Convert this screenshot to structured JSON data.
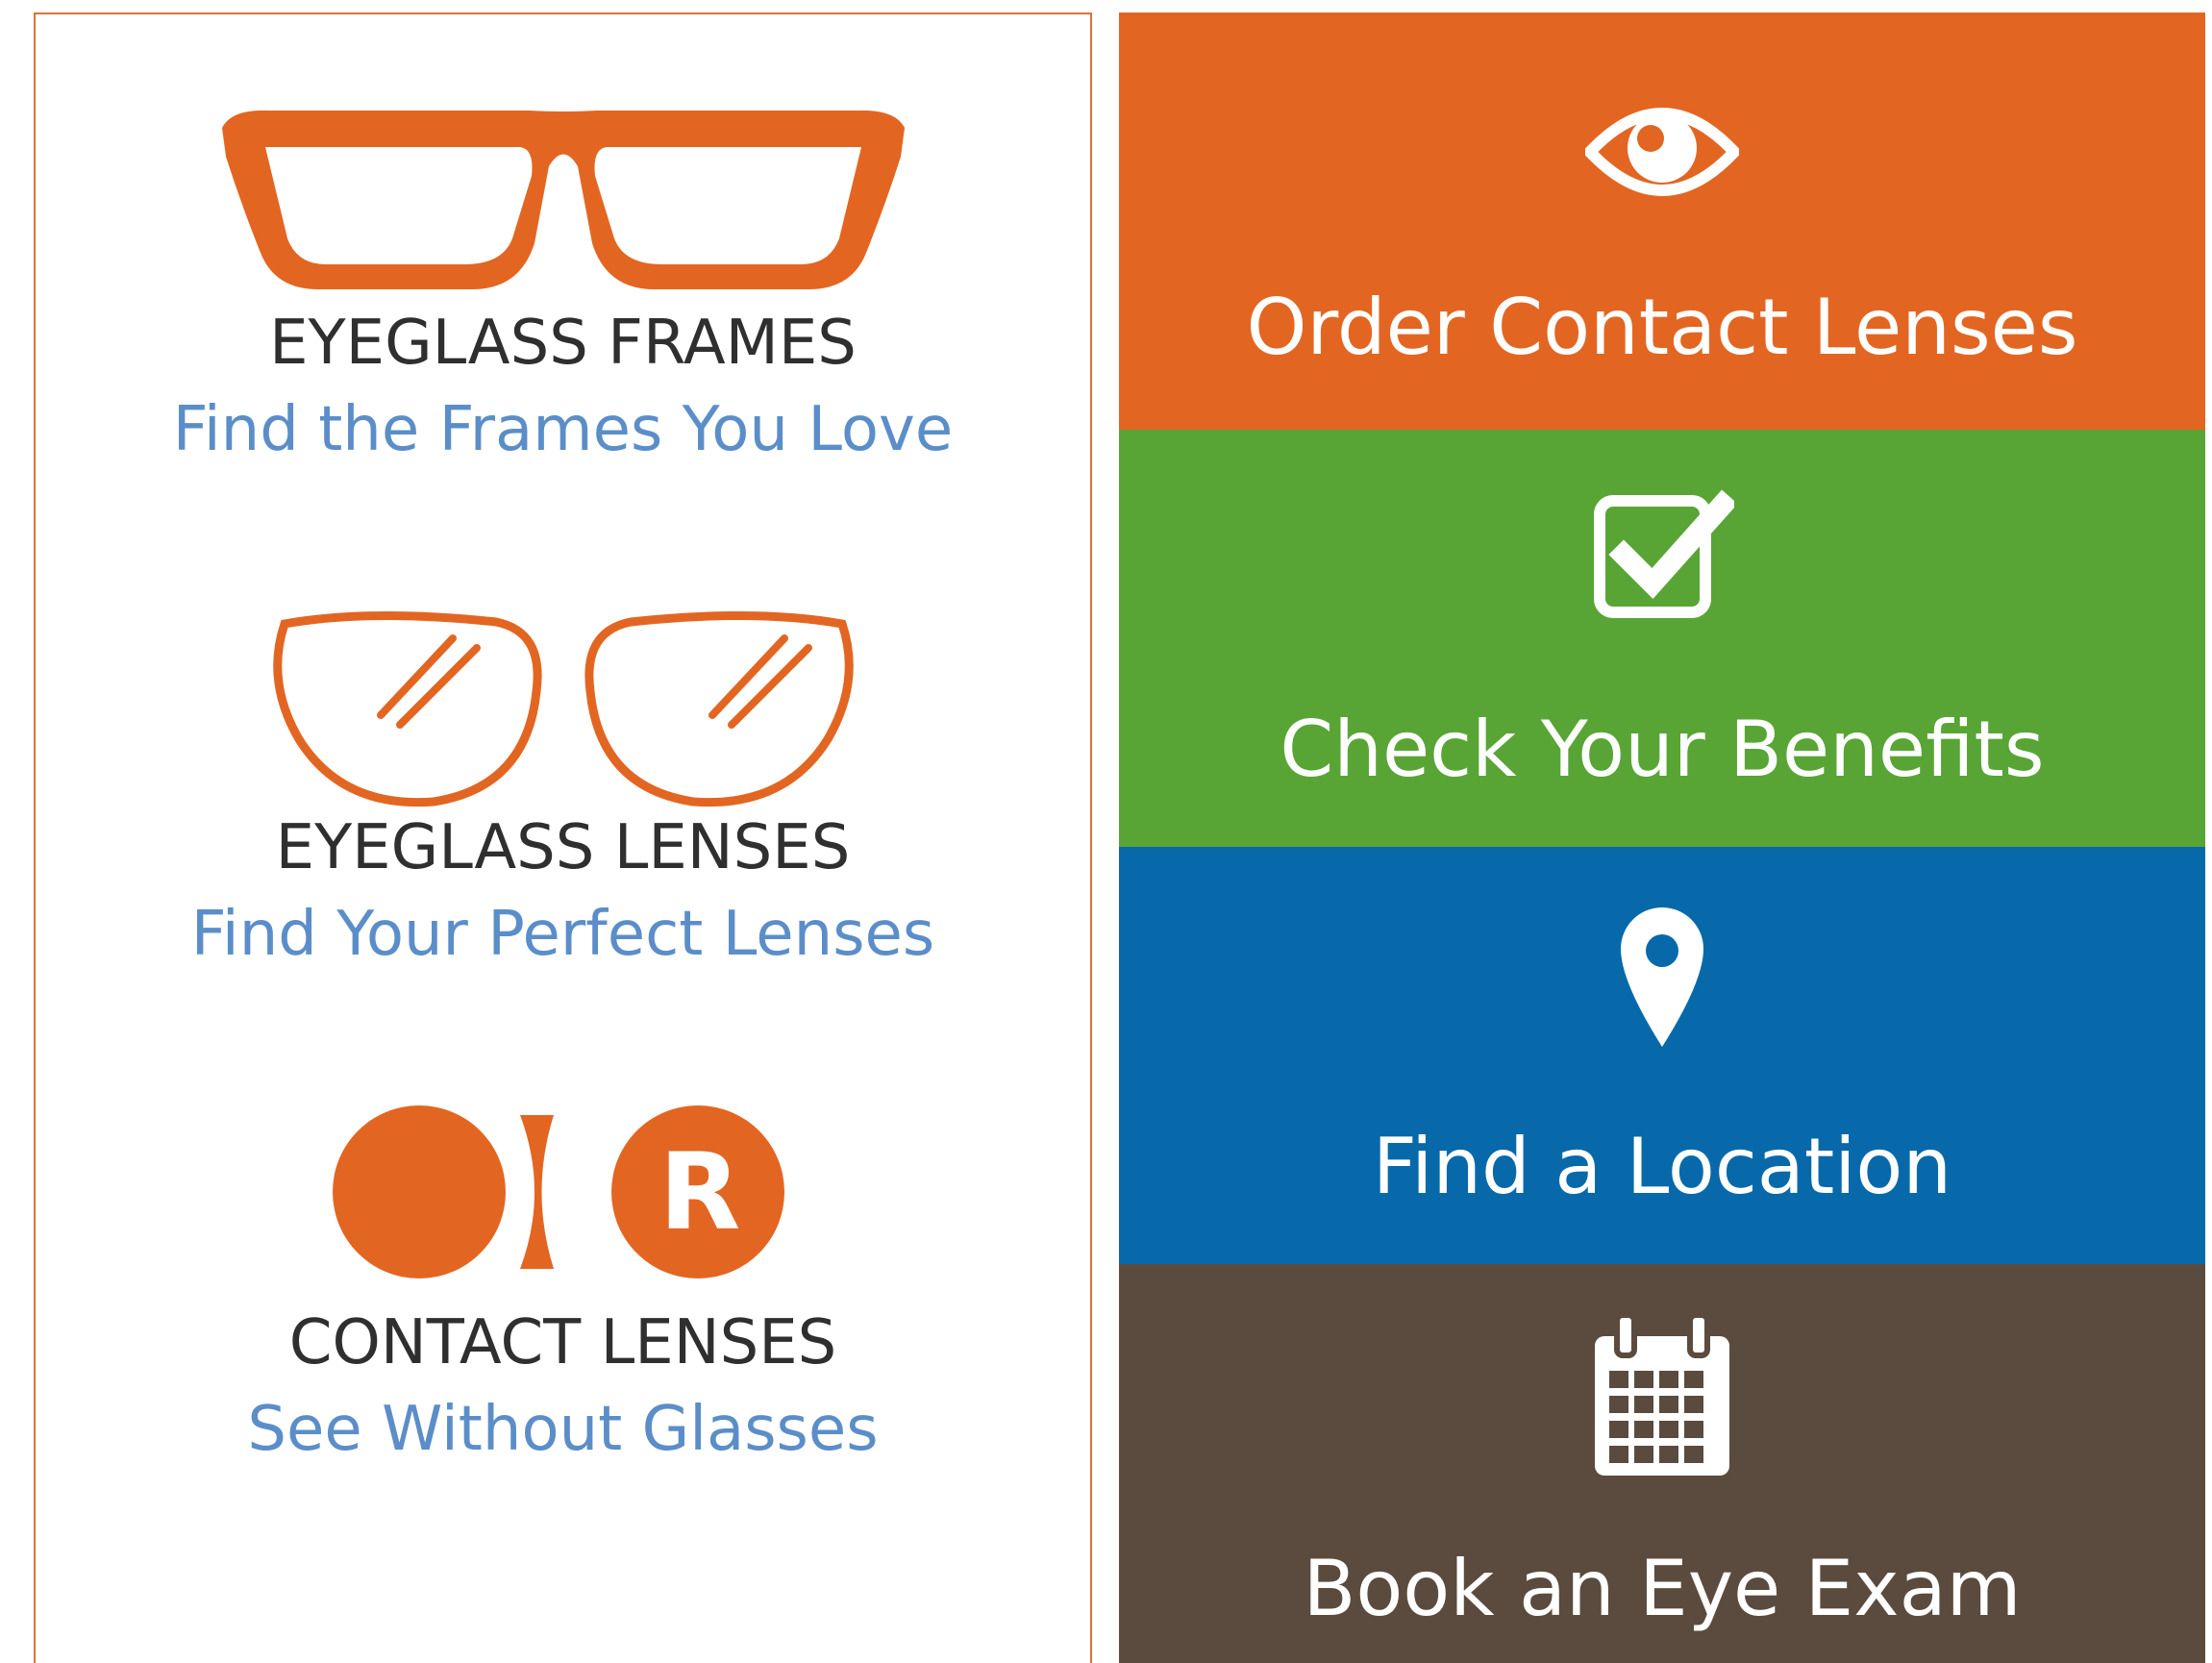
{
  "colors": {
    "orange": "#e26622",
    "green": "#58a535",
    "blue": "#0769aa",
    "brown": "#5b4b3e",
    "subtitle_blue": "#5b8ec9",
    "title_dark": "#2f2f2f"
  },
  "products": [
    {
      "title": "EYEGLASS FRAMES",
      "subtitle": "Find the Frames You Love",
      "icon": "eyeglass-frames-icon"
    },
    {
      "title": "EYEGLASS LENSES",
      "subtitle": "Find Your Perfect Lenses",
      "icon": "eyeglass-lenses-icon"
    },
    {
      "title": "CONTACT LENSES",
      "subtitle": "See Without Glasses",
      "icon": "contact-lenses-icon",
      "icon_letter": "R"
    }
  ],
  "actions": [
    {
      "label": "Order Contact Lenses",
      "icon": "eye-icon",
      "color": "#e26622"
    },
    {
      "label": "Check Your Benefits",
      "icon": "checkbox-icon",
      "color": "#58a535"
    },
    {
      "label": "Find a Location",
      "icon": "map-pin-icon",
      "color": "#0769aa"
    },
    {
      "label": "Book an Eye Exam",
      "icon": "calendar-icon",
      "color": "#5b4b3e"
    }
  ]
}
